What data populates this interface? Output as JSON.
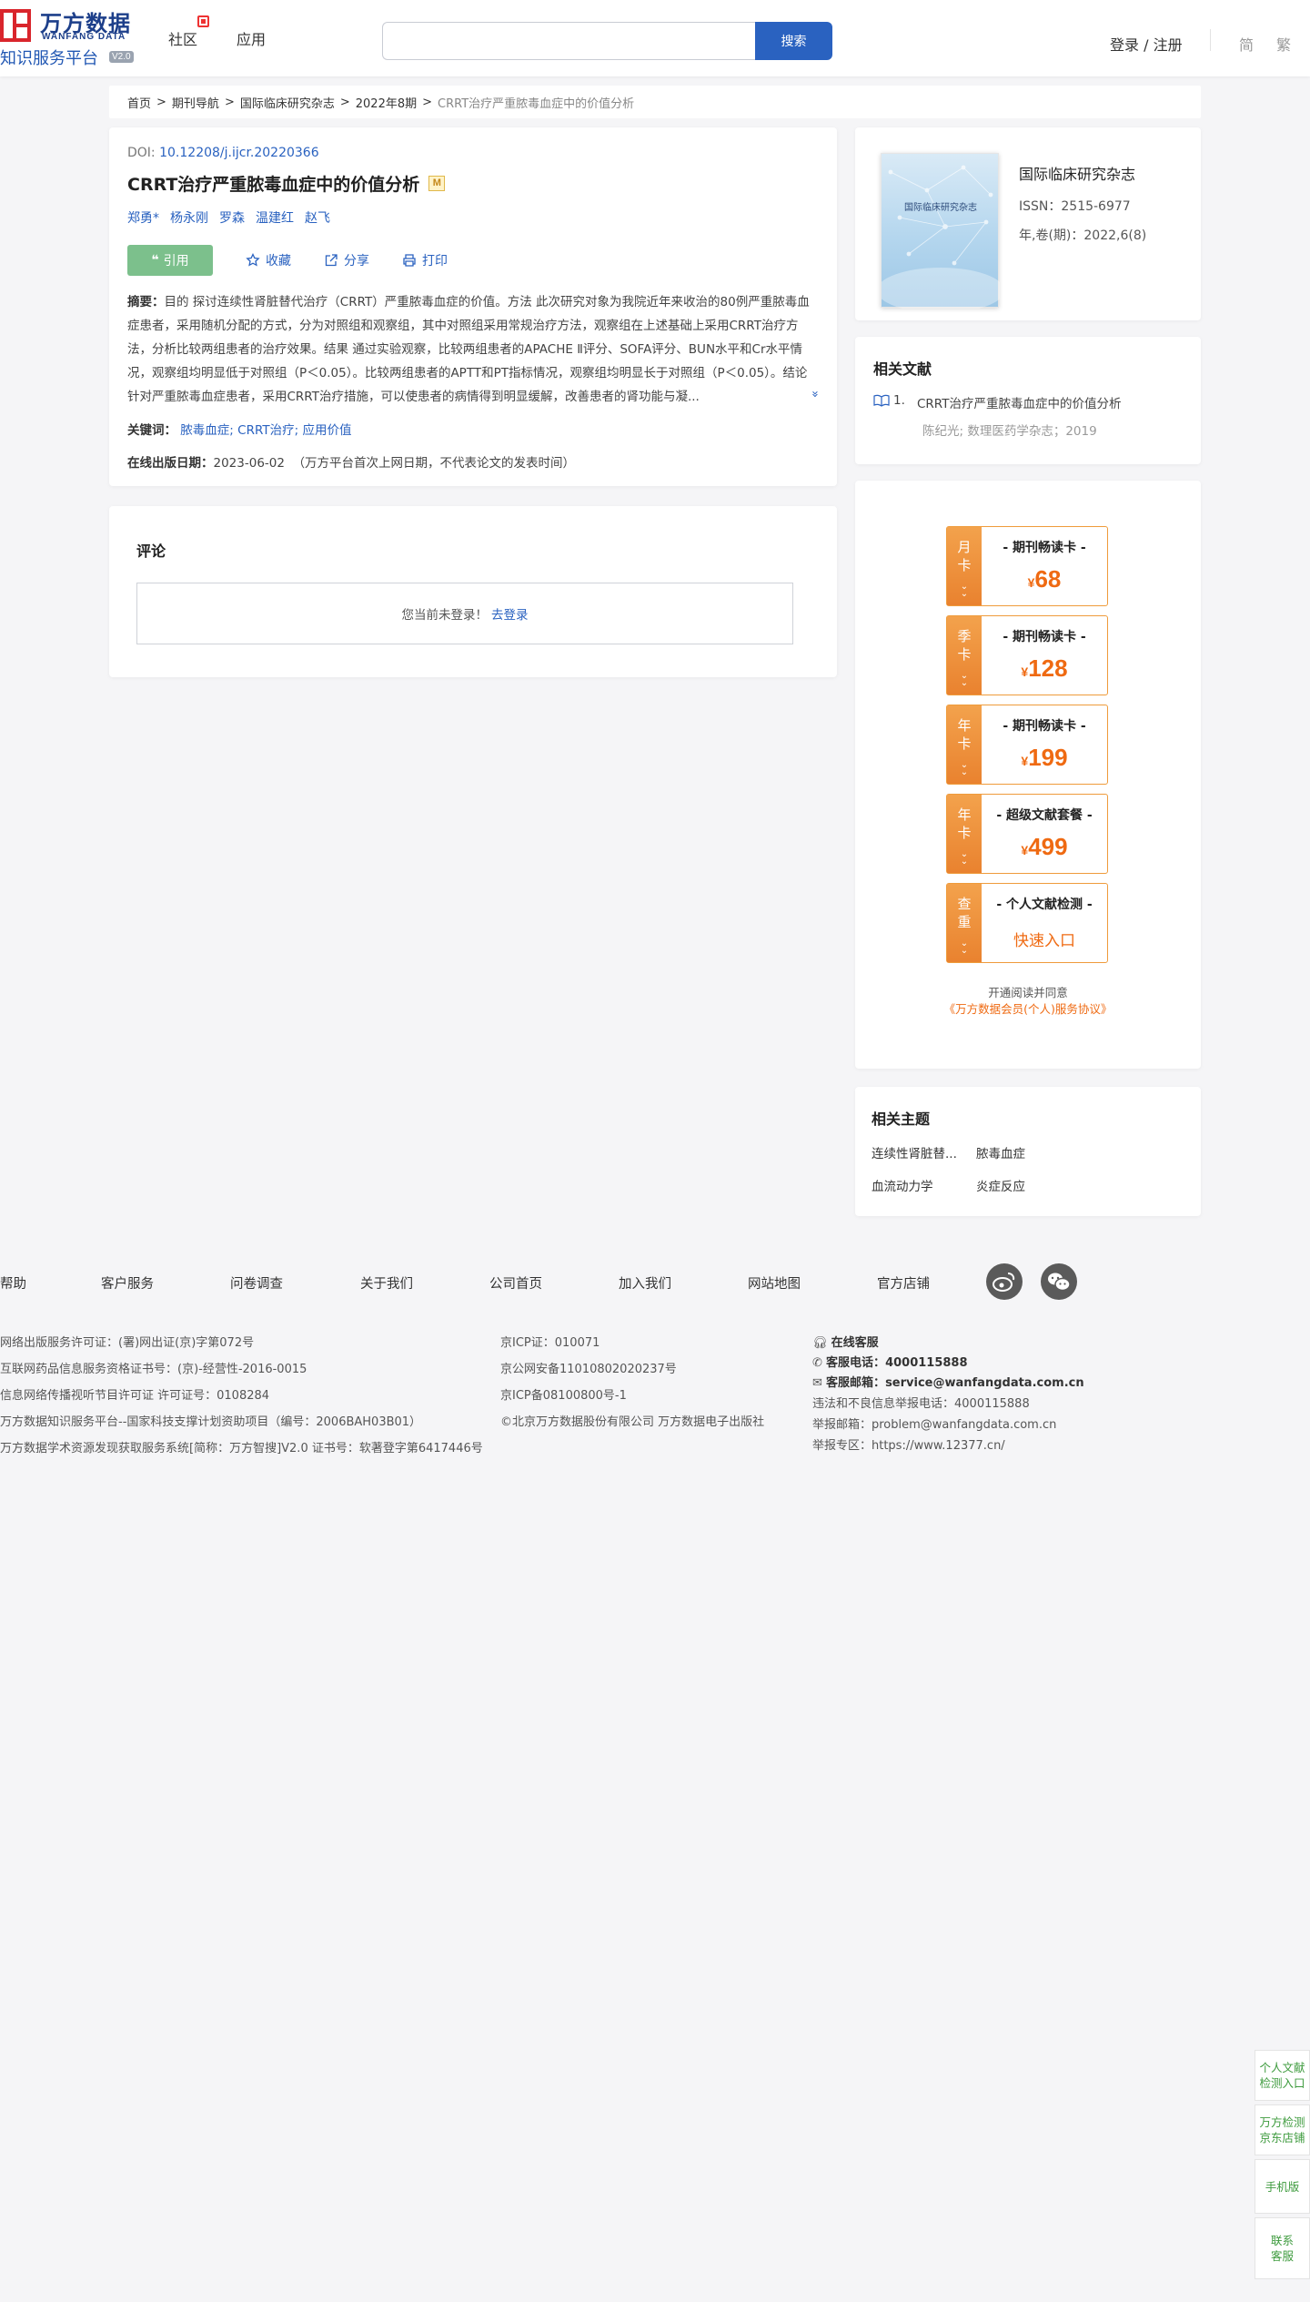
{
  "header": {
    "logo_cn": "万方数据",
    "logo_en": "WANFANG DATA",
    "logo_sub": "知识服务平台",
    "logo_ver": "V2.0",
    "nav": [
      "社区",
      "应用"
    ],
    "search_placeholder": "",
    "search_button": "搜索",
    "login": "登录 / 注册",
    "lang_simplified": "简",
    "lang_traditional": "繁"
  },
  "breadcrumb": [
    "首页",
    "期刊导航",
    "国际临床研究杂志",
    "2022年8期",
    "CRRT治疗严重脓毒血症中的价值分析"
  ],
  "article": {
    "doi_label": "DOI:",
    "doi": "10.12208/j.ijcr.20220366",
    "title": "CRRT治疗严重脓毒血症中的价值分析",
    "title_badge": "M",
    "authors": [
      "郑勇*",
      "杨永刚",
      "罗森",
      "温建红",
      "赵飞"
    ],
    "actions": {
      "cite": "引用",
      "favorite": "收藏",
      "share": "分享",
      "print": "打印"
    },
    "abstract_label": "摘要：",
    "abstract": "目的 探讨连续性肾脏替代治疗（CRRT）严重脓毒血症的价值。方法 此次研究对象为我院近年来收治的80例严重脓毒血症患者，采用随机分配的方式，分为对照组和观察组，其中对照组采用常规治疗方法，观察组在上述基础上采用CRRT治疗方法，分析比较两组患者的治疗效果。结果 通过实验观察，比较两组患者的APACHE Ⅱ评分、SOFA评分、BUN水平和Cr水平情况，观察组均明显低于对照组（P＜0.05）。比较两组患者的APTT和PT指标情况，观察组均明显长于对照组（P＜0.05）。结论 针对严重脓毒血症患者，采用CRRT治疗措施，可以使患者的病情得到明显缓解，改善患者的肾功能与凝...",
    "expand": "»",
    "keywords_label": "关键词：",
    "keywords": [
      "脓毒血症;",
      "CRRT治疗;",
      "应用价值"
    ],
    "pub_label": "在线出版日期：",
    "pub_date": "2023-06-02",
    "pub_note": "（万方平台首次上网日期，不代表论文的发表时间）"
  },
  "comment": {
    "title": "评论",
    "not_logged": "您当前未登录！",
    "login_link": "去登录"
  },
  "journal": {
    "cover_title": "国际临床研究杂志",
    "name": "国际临床研究杂志",
    "issn": "ISSN：2515-6977",
    "volume": "年,卷(期)：2022,6(8)"
  },
  "related": {
    "title": "相关文献",
    "items": [
      {
        "no": "1.",
        "title": "CRRT治疗严重脓毒血症中的价值分析",
        "meta": "陈纪光; 数理医药学杂志；2019"
      }
    ]
  },
  "promo": {
    "cards": [
      {
        "side": [
          "月",
          "卡"
        ],
        "top": "- 期刊畅读卡 -",
        "currency": "¥",
        "price": "68"
      },
      {
        "side": [
          "季",
          "卡"
        ],
        "top": "- 期刊畅读卡 -",
        "currency": "¥",
        "price": "128"
      },
      {
        "side": [
          "年",
          "卡"
        ],
        "top": "- 期刊畅读卡 -",
        "currency": "¥",
        "price": "199"
      },
      {
        "side": [
          "年",
          "卡"
        ],
        "top": "- 超级文献套餐 -",
        "currency": "¥",
        "price": "499"
      }
    ],
    "check": {
      "side": [
        "查",
        "重"
      ],
      "top": "- 个人文献检测 -",
      "entry": "快速入口"
    },
    "note1": "开通阅读并同意",
    "note2": "《万方数据会员(个人)服务协议》"
  },
  "topics": {
    "title": "相关主题",
    "tags": [
      "连续性肾脏替...",
      "脓毒血症",
      "血流动力学",
      "炎症反应"
    ]
  },
  "footer": {
    "nav": [
      "帮助",
      "客户服务",
      "问卷调查",
      "关于我们",
      "公司首页",
      "加入我们",
      "网站地图",
      "官方店铺"
    ],
    "col1": [
      "网络出版服务许可证：(署)网出证(京)字第072号",
      "互联网药品信息服务资格证书号：(京)-经营性-2016-0015",
      "信息网络传播视听节目许可证 许可证号：0108284",
      "万方数据知识服务平台--国家科技支撑计划资助项目（编号：2006BAH03B01）",
      "万方数据学术资源发现获取服务系统[简称：万方智搜]V2.0 证书号：软著登字第6417446号"
    ],
    "col2": [
      "京ICP证：010071",
      "京公网安备11010802020237号",
      "京ICP备08100800号-1",
      "©北京万方数据股份有限公司 万方数据电子出版社"
    ],
    "online": "在线客服",
    "phone_label": "客服电话：",
    "phone": "4000115888",
    "email_label": "客服邮箱：",
    "email": "service@wanfangdata.com.cn",
    "report_phone": "违法和不良信息举报电话：4000115888",
    "report_email": "举报邮箱：problem@wanfangdata.com.cn",
    "report_zone": "举报专区：https://www.12377.cn/"
  },
  "float": [
    "个人文献检测入口",
    "万方检测京东店铺",
    "手机版",
    "联系客服"
  ]
}
